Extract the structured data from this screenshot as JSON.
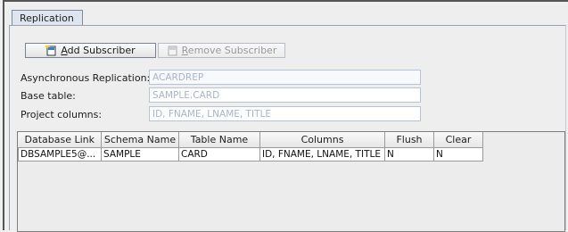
{
  "tabs": [
    {
      "label": "Replication"
    }
  ],
  "toolbar": {
    "add_label": "Add Subscriber",
    "add_mnemonic": "A",
    "add_rest": "dd Subscriber",
    "remove_label": "Remove Subscriber",
    "remove_mnemonic": "R",
    "remove_rest": "emove Subscriber"
  },
  "form": {
    "async_label": "Asynchronous Replication:",
    "async_value": "ACARDREP",
    "base_label": "Base table:",
    "base_value": "SAMPLE.CARD",
    "project_label": "Project columns:",
    "project_value": "ID, FNAME, LNAME, TITLE"
  },
  "table": {
    "columns": [
      "Database Link",
      "Schema Name",
      "Table Name",
      "Columns",
      "Flush",
      "Clear"
    ],
    "rows": [
      [
        "DBSAMPLE5@...",
        "SAMPLE",
        "CARD",
        "ID, FNAME, LNAME, TITLE",
        "N",
        "N"
      ]
    ]
  },
  "icons": {
    "add": "add-subscriber-icon",
    "remove": "remove-subscriber-icon"
  }
}
